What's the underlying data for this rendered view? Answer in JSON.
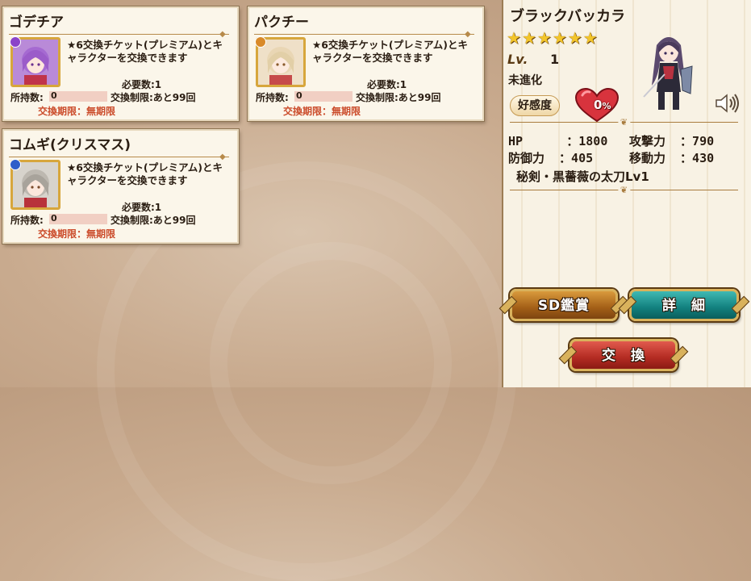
{
  "cards": [
    {
      "name": "ゴデチア",
      "rank_color": "#8b43c9",
      "description": "★6交換チケット(プレミアム)とキャラクターを交換できます",
      "required": "必要数:1",
      "owned_label": "所持数:",
      "owned_value": "0",
      "limit": "交換制限:あと99回",
      "period": "交換期限：無期限"
    },
    {
      "name": "パクチー",
      "rank_color": "#d98a2a",
      "description": "★6交換チケット(プレミアム)とキャラクターを交換できます",
      "required": "必要数:1",
      "owned_label": "所持数:",
      "owned_value": "0",
      "limit": "交換制限:あと99回",
      "period": "交換期限：無期限"
    },
    {
      "name": "コムギ(クリスマス)",
      "rank_color": "#2f5ec9",
      "description": "★6交換チケット(プレミアム)とキャラクターを交換できます",
      "required": "必要数:1",
      "owned_label": "所持数:",
      "owned_value": "0",
      "limit": "交換制限:あと99回",
      "period": "交換期限：無期限"
    }
  ],
  "detail": {
    "name": "ブラックバッカラ",
    "stars": [
      "★",
      "★",
      "★",
      "★",
      "★",
      "★"
    ],
    "level_label": "Lv.",
    "level_value": "1",
    "evolution": "未進化",
    "affection_label": "好感度",
    "affection_value": "0",
    "affection_unit": "%",
    "stats": {
      "hp": "HP      ：1800",
      "attack": "攻撃力  ：790",
      "defense": "防御力  ：405",
      "move": "移動力  ：430"
    },
    "skill": "秘剣・黒薔薇の太刀Lv1"
  },
  "buttons": {
    "sd_view": "SD鑑賞",
    "detail": "詳　細",
    "trade": "交　換"
  },
  "icons": {
    "sound": "speaker-icon",
    "heart": "heart-icon"
  }
}
